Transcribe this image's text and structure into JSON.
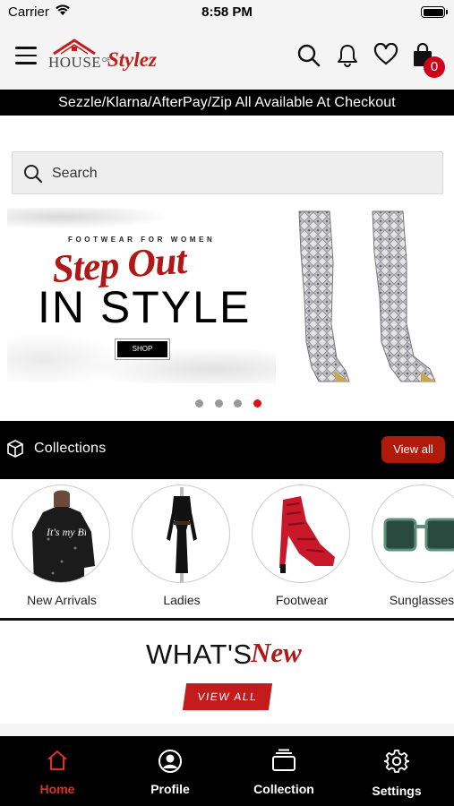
{
  "status_bar": {
    "carrier": "Carrier",
    "time": "8:58 PM"
  },
  "header": {
    "logo": {
      "word_house": "HOUSE",
      "word_of": "OF",
      "word_stylez": "Stylez"
    },
    "cart_count": "0",
    "icons": [
      "menu-icon",
      "search-icon",
      "bell-icon",
      "heart-icon",
      "shopping-bag-icon"
    ]
  },
  "promo": {
    "text": "Sezzle/Klarna/AfterPay/Zip All Available At Checkout"
  },
  "search": {
    "placeholder": "Search"
  },
  "hero": {
    "kicker": "FOOTWEAR FOR WOMEN",
    "script": "Step Out",
    "headline": "IN STYLE",
    "shop_label": "SHOP",
    "slide_count": 4,
    "active_slide": 4
  },
  "collections": {
    "title": "Collections",
    "view_all": "View all",
    "items": [
      {
        "label": "New Arrivals",
        "shirt_text": "It's my Birthday"
      },
      {
        "label": "Ladies"
      },
      {
        "label": "Footwear"
      },
      {
        "label": "Sunglasses"
      }
    ]
  },
  "whats_new": {
    "title": "WHAT'S",
    "script": "New",
    "button": "VIEW ALL"
  },
  "tab_bar": {
    "active": "Home",
    "tabs": [
      {
        "label": "Home",
        "icon": "home-icon"
      },
      {
        "label": "Profile",
        "icon": "user-circle-icon"
      },
      {
        "label": "Collection",
        "icon": "stack-icon"
      },
      {
        "label": "Settings",
        "icon": "gear-icon"
      }
    ]
  },
  "colors": {
    "accent_red": "#c41c1c",
    "view_all_red": "#b01a0b",
    "badge_red": "#d0021b",
    "active_tab": "#e0301e",
    "dot_active": "#e01010",
    "dot_inactive": "#999999"
  }
}
